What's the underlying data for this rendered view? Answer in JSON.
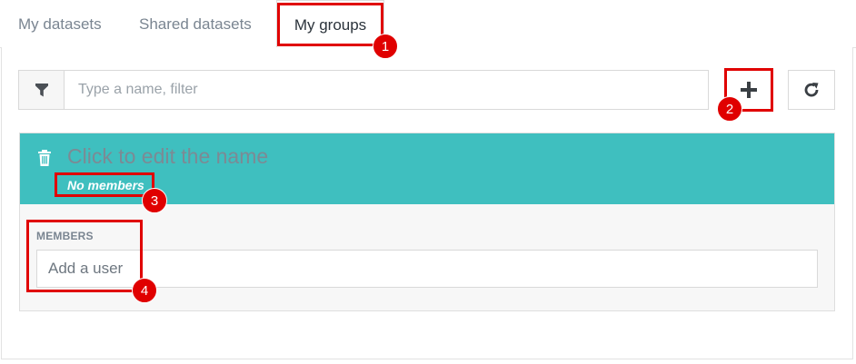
{
  "tabs": [
    {
      "label": "My datasets",
      "active": false
    },
    {
      "label": "Shared datasets",
      "active": false
    },
    {
      "label": "My groups",
      "active": true
    }
  ],
  "toolbar": {
    "filter_placeholder": "Type a name, filter",
    "filter_icon": "filter-icon",
    "add_icon": "plus-icon",
    "refresh_icon": "refresh-icon"
  },
  "group": {
    "name_placeholder": "Click to edit the name",
    "members_count": "No members",
    "delete_icon": "trash-icon",
    "members_label": "MEMBERS",
    "add_user_placeholder": "Add a user"
  },
  "annotations": {
    "marker_1": "1",
    "marker_2": "2",
    "marker_3": "3",
    "marker_4": "4"
  },
  "colors": {
    "accent": "#3fbfbf",
    "callout": "#e00000"
  }
}
